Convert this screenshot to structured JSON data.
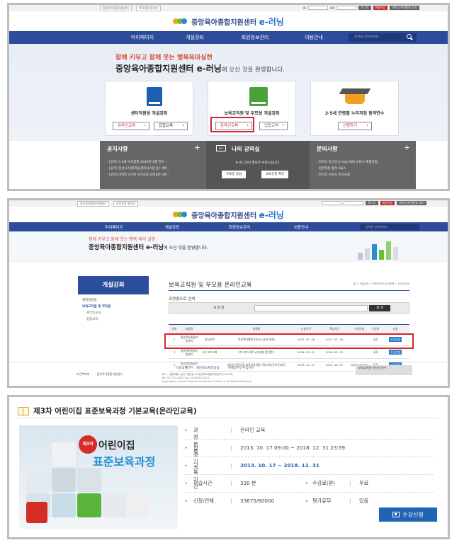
{
  "panel1": {
    "topbar": {
      "links": [
        "중앙육아종합지원센터",
        "보육과정 알리미"
      ],
      "id_label": "ID",
      "pw_label": "PW",
      "login": "로그인",
      "join": "회원가입",
      "find": "아이디/비밀번호 찾기"
    },
    "logo": {
      "text": "중앙육아종합지원센터",
      "brand": "e-러닝"
    },
    "nav": {
      "items": [
        "마이페이지",
        "개설강좌",
        "회원정보관리",
        "이용안내"
      ],
      "search_placeholder": "검색을 입력하세요."
    },
    "hero": {
      "subtitle": "함께 키우고 함께 웃는 행복육아실현",
      "title": "중앙육아종합지원센터 e-러닝",
      "title_suffix": "에 오신 것을 환영합니다."
    },
    "cards": [
      {
        "title": "센터직원용 개설강좌",
        "btn1": "온라인교육",
        "btn2": "집합교육"
      },
      {
        "title": "보육교직원 및 부모용 개설강좌",
        "btn1": "온라인교육",
        "btn2": "집합교육"
      },
      {
        "title": "3-5세 연령별 누리과정 원격연수",
        "btn1": "신청하기"
      }
    ],
    "notice": {
      "head": "공지사항",
      "items": [
        "· [공지] 3-5세 누리과정 2018년 4월 연수 ·",
        "· [공지] 전산시스템(학습관리시스템 등) 서버 ·",
        "· [공지] [변경] 3-5세 누리과정 2018년 3월 ·"
      ]
    },
    "my": {
      "badge": "MY",
      "head": "나의 강의실",
      "msg": "※ 로그인이 필요한 서비스입니다.",
      "btn1": "수료증 발급",
      "btn2": "교육신청 확인"
    },
    "faq": {
      "head": "문의사항",
      "items": [
        "· 아이디 로그인시 http 500 오류시 해결방법 ·",
        "· 원연계정 접속 Q&A",
        "· 온라인 수강시 주의사항"
      ]
    }
  },
  "panel2": {
    "topbar": {
      "links": [
        "중앙육아종합지원센터",
        "보육과정 알리미"
      ],
      "login": "로그인",
      "join": "회원가입",
      "find": "아이디/비밀번호 찾기"
    },
    "logo": {
      "text": "중앙육아종합지원센터",
      "brand": "e-러닝"
    },
    "nav": {
      "items": [
        "마이페이지",
        "개설강좌",
        "회원정보관리",
        "이용안내"
      ],
      "search_placeholder": "검색을 입력하세요."
    },
    "hero": {
      "subtitle": "함께 키우고 함께 웃는 행복 육아 실현",
      "title": "중앙육아종합지원센터 e-러닝",
      "title_suffix": "에 오신 것을 환영합니다."
    },
    "sidebar": {
      "head": "개설강좌",
      "items": [
        "센터직원용",
        "보육교직원 및 부모용",
        "온라인교육",
        "집합교육"
      ]
    },
    "content": {
      "title": "보육교직원 및 부모용 온라인교육",
      "breadcrumb": "홈 > 개설강좌 > 보육교직원 및 부모용 > 온라인교육",
      "section": "과정명으로 검색",
      "search_label": "과 정 명",
      "search_btn": "검 색",
      "table": {
        "headers": [
          "번호",
          "분류명",
          "과정명",
          "",
          "신청기간",
          "학습기간",
          "수강인원",
          "수강료",
          "신청"
        ],
        "rows": [
          [
            "2",
            "중앙육아종합지원센터",
            "양성교육",
            "아동학대예방교육(2018년 개정)",
            "2017. 07. 28",
            "2017. 07. 19",
            "",
            "무료",
            "수강신청"
          ],
          [
            "3",
            "중앙육아종합지원센터",
            "2차 보수교육",
            "2차 보수교육 누리과정 원격연수",
            "2018. 03. 02",
            "2018. 03. 02",
            "",
            "무료",
            "수강신청"
          ],
          [
            "4",
            "중앙육아종합지원센터",
            "",
            "제3차 어린이집 표준보육과정 기본교육(온라인교육)",
            "2013. 10. 17",
            "2013. 10. 17",
            "33675/60000",
            "무료",
            "수강신청"
          ]
        ]
      }
    },
    "footer": {
      "links": [
        "이용약관",
        "개인정보처리방침",
        "이메일무단수집거부"
      ],
      "addr": "주소 : 서울특별시 중구 명동길 26 중앙육아종합지원센터 (04536)",
      "tel": "Tel : 02-701-0431   Fax : 02-6901-0221",
      "copy": "Copyright(c) Central Support Center For Childcare. All Rights Reserved.",
      "org1": "보건복지부",
      "org2": "중앙육아종합지원센터",
      "select": "보육교직원 인터넷 연수"
    }
  },
  "panel3": {
    "title": "제3차 어린이집 표준보육과정 기본교육(온라인교육)",
    "thumb": {
      "badge": "제3차",
      "line1": "어린이집",
      "line2": "표준보육과정"
    },
    "rows": [
      {
        "label": "과정분류",
        "value": "온라인 교육"
      },
      {
        "label": "신청기간",
        "value": "2013. 10. 17 09:00 ~ 2018. 12. 31 23:59"
      },
      {
        "label": "교육기간",
        "value": "2013. 10. 17 ~ 2018. 12. 31"
      },
      {
        "label": "학습시간",
        "value": "330 분",
        "label2": "수강료(원)",
        "value2": "무료"
      },
      {
        "label": "신청/전체",
        "value": "33675/60000",
        "label2": "평가유무",
        "value2": "있음"
      }
    ],
    "enroll": "수강신청"
  },
  "colors": {
    "nav": "#2e4c9c",
    "highlight": "#d8232a",
    "accent_blue": "#2160b8",
    "enroll_button": "#1f63b3"
  }
}
